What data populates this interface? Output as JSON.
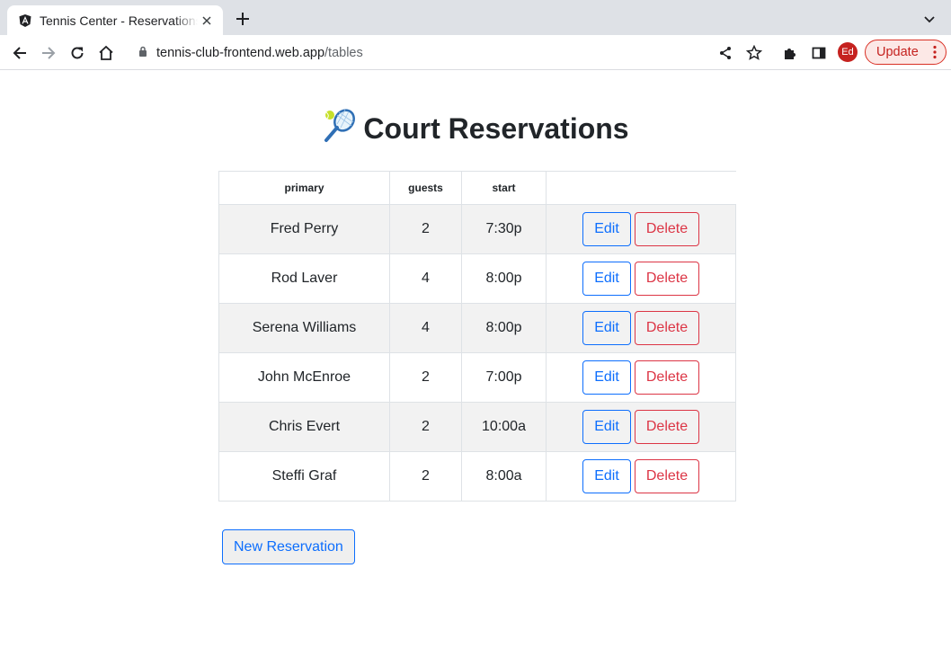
{
  "browser": {
    "tab_title": "Tennis Center - Reservations",
    "url_host": "tennis-club-frontend.web.app",
    "url_path": "/tables",
    "avatar_initials": "Ed",
    "update_label": "Update"
  },
  "page": {
    "title": "Court Reservations",
    "title_icon": "tennis-racket-icon"
  },
  "table": {
    "headers": [
      "primary",
      "guests",
      "start",
      ""
    ],
    "rows": [
      {
        "primary": "Fred Perry",
        "guests": "2",
        "start": "7:30p"
      },
      {
        "primary": "Rod Laver",
        "guests": "4",
        "start": "8:00p"
      },
      {
        "primary": "Serena Williams",
        "guests": "4",
        "start": "8:00p"
      },
      {
        "primary": "John McEnroe",
        "guests": "2",
        "start": "7:00p"
      },
      {
        "primary": "Chris Evert",
        "guests": "2",
        "start": "10:00a"
      },
      {
        "primary": "Steffi Graf",
        "guests": "2",
        "start": "8:00a"
      }
    ],
    "edit_label": "Edit",
    "delete_label": "Delete"
  },
  "new_reservation_label": "New Reservation",
  "colors": {
    "primary": "#0d6efd",
    "danger": "#dc3545",
    "stripe": "#f2f2f2"
  }
}
